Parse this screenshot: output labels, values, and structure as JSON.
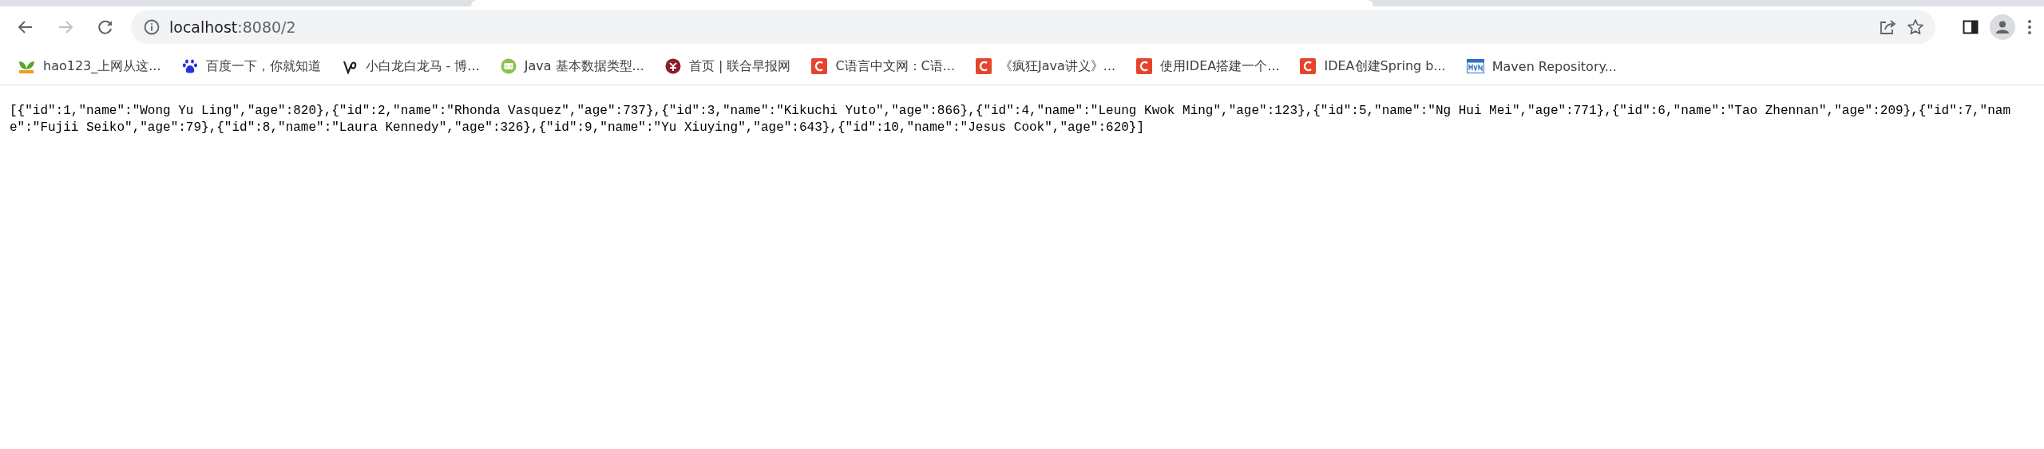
{
  "address_bar": {
    "url_host": "localhost",
    "url_rest": ":8080/2"
  },
  "bookmarks": [
    {
      "label": "hao123_上网从这...",
      "kind": "hao"
    },
    {
      "label": "百度一下，你就知道",
      "kind": "paw"
    },
    {
      "label": "小白龙白龙马 - 博...",
      "kind": "swirl"
    },
    {
      "label": "Java 基本数据类型...",
      "kind": "code"
    },
    {
      "label": "首页 | 联合早报网",
      "kind": "round"
    },
    {
      "label": "C语言中文网：C语...",
      "kind": "c"
    },
    {
      "label": "《疯狂Java讲义》...",
      "kind": "c"
    },
    {
      "label": "使用IDEA搭建一个...",
      "kind": "c"
    },
    {
      "label": "IDEA创建Spring b...",
      "kind": "c"
    },
    {
      "label": "Maven Repository...",
      "kind": "mvn"
    }
  ],
  "body_text": "[{\"id\":1,\"name\":\"Wong Yu Ling\",\"age\":820},{\"id\":2,\"name\":\"Rhonda Vasquez\",\"age\":737},{\"id\":3,\"name\":\"Kikuchi Yuto\",\"age\":866},{\"id\":4,\"name\":\"Leung Kwok Ming\",\"age\":123},{\"id\":5,\"name\":\"Ng Hui Mei\",\"age\":771},{\"id\":6,\"name\":\"Tao Zhennan\",\"age\":209},{\"id\":7,\"name\":\"Fujii Seiko\",\"age\":79},{\"id\":8,\"name\":\"Laura Kennedy\",\"age\":326},{\"id\":9,\"name\":\"Yu Xiuying\",\"age\":643},{\"id\":10,\"name\":\"Jesus Cook\",\"age\":620}]"
}
